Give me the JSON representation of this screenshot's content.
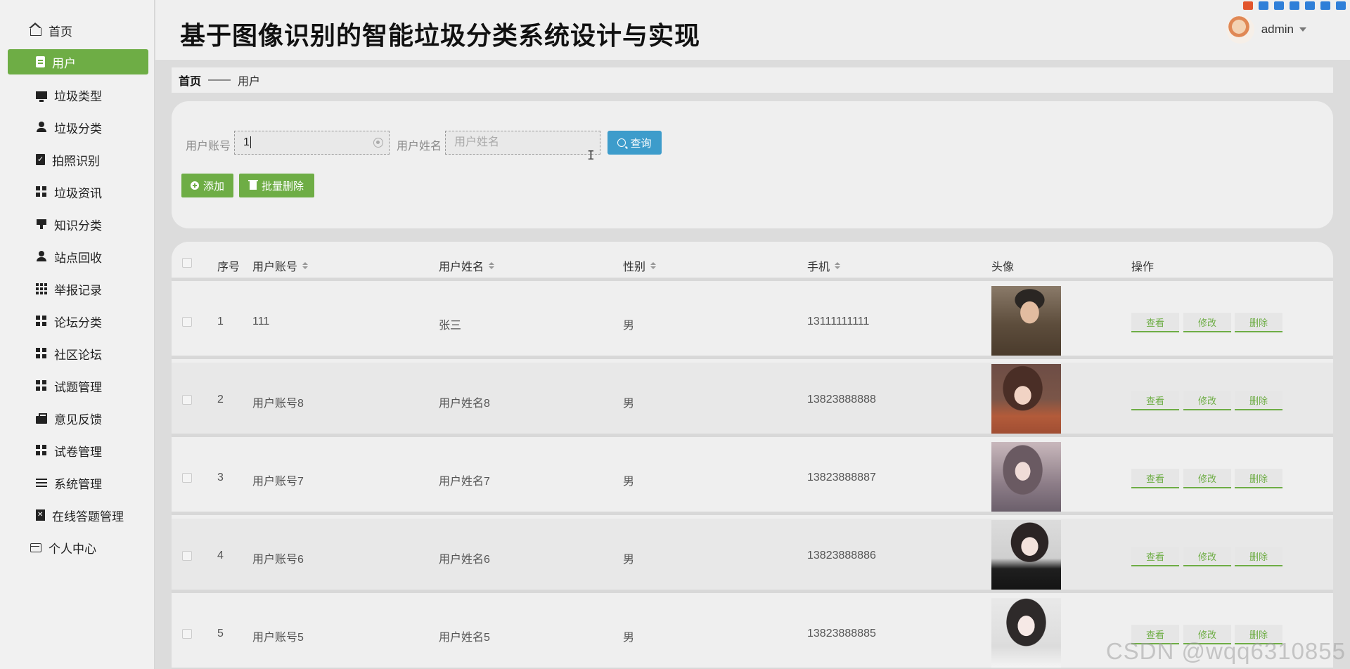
{
  "header": {
    "title": "基于图像识别的智能垃圾分类系统设计与实现",
    "username": "admin"
  },
  "sidebar": {
    "home": "首页",
    "items": [
      {
        "label": "用户",
        "icon": "clipboard-icon"
      },
      {
        "label": "垃圾类型",
        "icon": "monitor-icon"
      },
      {
        "label": "垃圾分类",
        "icon": "user-icon"
      },
      {
        "label": "拍照识别",
        "icon": "clipboard-check-icon"
      },
      {
        "label": "垃圾资讯",
        "icon": "grid-icon"
      },
      {
        "label": "知识分类",
        "icon": "brush-icon"
      },
      {
        "label": "站点回收",
        "icon": "user-icon"
      },
      {
        "label": "举报记录",
        "icon": "grid9-icon"
      },
      {
        "label": "论坛分类",
        "icon": "grid-icon"
      },
      {
        "label": "社区论坛",
        "icon": "grid-icon"
      },
      {
        "label": "试题管理",
        "icon": "grid-icon"
      },
      {
        "label": "意见反馈",
        "icon": "briefcase-icon"
      },
      {
        "label": "试卷管理",
        "icon": "grid-icon"
      },
      {
        "label": "系统管理",
        "icon": "list-icon"
      },
      {
        "label": "在线答题管理",
        "icon": "doc-x-icon"
      }
    ],
    "profile": "个人中心",
    "active_color": "#6ead45"
  },
  "breadcrumb": {
    "home": "首页",
    "separator": "——",
    "current": "用户"
  },
  "search": {
    "account_label": "用户账号",
    "account_value": "1",
    "name_label": "用户姓名",
    "name_placeholder": "用户姓名",
    "query_button": "查询",
    "add_button": "添加",
    "batch_delete_button": "批量删除"
  },
  "table": {
    "columns": [
      "序号",
      "用户账号",
      "用户姓名",
      "性别",
      "手机",
      "头像",
      "操作"
    ],
    "rows": [
      {
        "index": "1",
        "account": "111",
        "name": "张三",
        "gender": "男",
        "phone": "13111111111"
      },
      {
        "index": "2",
        "account": "用户账号8",
        "name": "用户姓名8",
        "gender": "男",
        "phone": "13823888888"
      },
      {
        "index": "3",
        "account": "用户账号7",
        "name": "用户姓名7",
        "gender": "男",
        "phone": "13823888887"
      },
      {
        "index": "4",
        "account": "用户账号6",
        "name": "用户姓名6",
        "gender": "男",
        "phone": "13823888886"
      },
      {
        "index": "5",
        "account": "用户账号5",
        "name": "用户姓名5",
        "gender": "男",
        "phone": "13823888885"
      }
    ],
    "actions": {
      "view": "查看",
      "edit": "修改",
      "delete": "删除"
    }
  },
  "watermark": "CSDN @wqq6310855",
  "colors": {
    "accent": "#6ead45",
    "query": "#3d9ccb"
  }
}
